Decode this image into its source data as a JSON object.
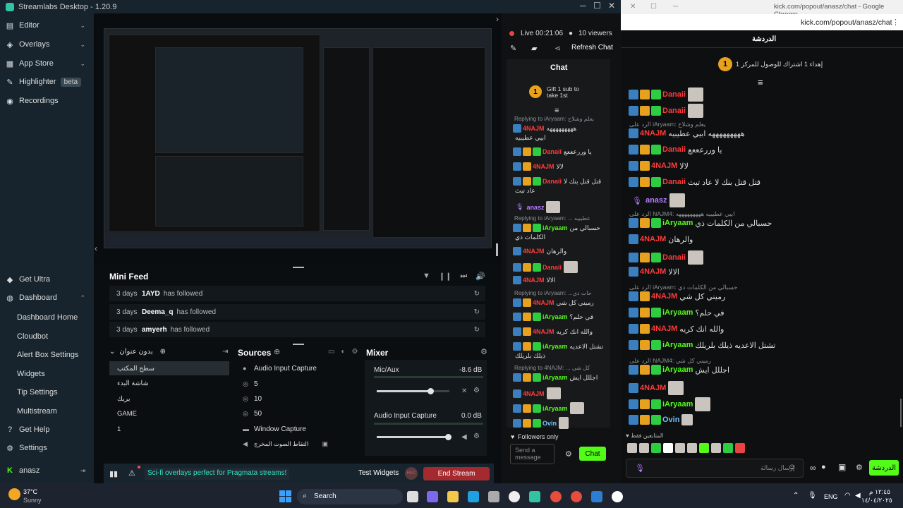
{
  "app": {
    "title": "Streamlabs Desktop - 1.20.9"
  },
  "sidebar": {
    "items": [
      {
        "label": "Editor"
      },
      {
        "label": "Overlays"
      },
      {
        "label": "App Store"
      },
      {
        "label": "Highlighter",
        "badge": "beta"
      },
      {
        "label": "Recordings"
      },
      {
        "label": "Get Ultra"
      },
      {
        "label": "Dashboard"
      },
      {
        "label": "Get Help"
      },
      {
        "label": "Settings"
      }
    ],
    "dashboard_subitems": [
      "Dashboard Home",
      "Cloudbot",
      "Alert Box Settings",
      "Widgets",
      "Tip Settings",
      "Multistream"
    ],
    "user": "anasz"
  },
  "minifeed": {
    "title": "Mini Feed",
    "rows": [
      {
        "ago": "3 days",
        "name": "1AYD",
        "action": "has followed"
      },
      {
        "ago": "3 days",
        "name": "Deema_q",
        "action": "has followed"
      },
      {
        "ago": "3 days",
        "name": "amyerh",
        "action": "has followed"
      }
    ]
  },
  "scenes": {
    "title": "بدون عنوان",
    "items": [
      "سطح المكتب",
      "شاشة البدء",
      "بريك",
      "GAME",
      "1"
    ]
  },
  "sources": {
    "title": "Sources",
    "items": [
      "Audio Input Capture",
      "5",
      "10",
      "50",
      "Window Capture",
      "التقاط الصوت المخرج"
    ]
  },
  "mixer": {
    "title": "Mixer",
    "channels": [
      {
        "name": "Mic/Aux",
        "db": "-8.6 dB",
        "level": 0.75
      },
      {
        "name": "Audio Input Capture",
        "db": "0.0 dB",
        "level": 1.0
      }
    ]
  },
  "status": {
    "promo": "Sci-fi overlays perfect for Pragmata streams!",
    "test_widgets": "Test Widgets",
    "rec": "REC",
    "end_stream": "End Stream"
  },
  "live": {
    "time": "Live 00:21:06",
    "viewers": "10 viewers",
    "refresh": "Refresh Chat"
  },
  "dock_chat": {
    "header": "Chat",
    "gift": "Gift 1 sub to take 1st",
    "replies": [
      "Replying to iAryaam: يعلم وشلاح",
      "Replying to iAryaam: ... عطيبيه",
      "Replying to iAryaam: ...حات دي",
      "Replying to 4NAJM: ... كل شي"
    ],
    "lines": [
      {
        "name": "4NAJM",
        "msg": "هههههههههه"
      },
      {
        "name": "",
        "msg": "ابيي عطيبيه"
      },
      {
        "name": "Danaii",
        "msg": "يا وررعععع"
      },
      {
        "name": "4NAJM",
        "msg": "لالا"
      },
      {
        "name": "Danaii",
        "msg": "قتل قتل بنك لا"
      },
      {
        "name": "",
        "msg": "عاد تبث"
      },
      {
        "name": "anasz",
        "msg": ""
      },
      {
        "name": "iAryaam",
        "msg": "حسبالي من"
      },
      {
        "name": "",
        "msg": "الكلمات ذي"
      },
      {
        "name": "4NAJM",
        "msg": "والرهان"
      },
      {
        "name": "Danaii",
        "msg": ""
      },
      {
        "name": "4NAJM",
        "msg": "الالا"
      },
      {
        "name": "4NAJM",
        "msg": "رميني كل شي"
      },
      {
        "name": "iAryaam",
        "msg": "في حلم؟"
      },
      {
        "name": "4NAJM",
        "msg": "والله انك كريه"
      },
      {
        "name": "iAryaam",
        "msg": "تشتل الاعديه"
      },
      {
        "name": "",
        "msg": "ذيلك بلريلك"
      },
      {
        "name": "iAryaam",
        "msg": "اجللل ايش"
      },
      {
        "name": "4NAJM",
        "msg": ""
      },
      {
        "name": "iAryaam",
        "msg": ""
      },
      {
        "name": "Ovin",
        "msg": ""
      }
    ],
    "followers_only": "Followers only",
    "placeholder": "Send a message",
    "send": "Chat"
  },
  "kick": {
    "window_title": "kick.com/popout/anasz/chat - Google Chrome",
    "url": "kick.com/popout/anasz/chat",
    "header": "الدردشة",
    "gift": "إهداء 1 اشتراك للوصول للمركز 1",
    "replies": [
      "الرد على iAryaam: يعلم وشلاح",
      "الرد على NAJM4: ابيي عطيبيه هههههههههه",
      "الرد على iAryaam: حسبالي من الكلمات ذي",
      "الرد على NAJM4: رميني كل شي"
    ],
    "lines": [
      {
        "name": "Danaii",
        "msg": ""
      },
      {
        "name": "Danaii",
        "msg": ""
      },
      {
        "name": "4NAJM",
        "msg": "هههههههههه ابيي عطيبيه"
      },
      {
        "name": "Danaii",
        "msg": "يا وررعععع"
      },
      {
        "name": "4NAJM",
        "msg": "لالا"
      },
      {
        "name": "Danaii",
        "msg": "قتل قتل بنك لا عاد تبث"
      },
      {
        "name": "anasz",
        "msg": ""
      },
      {
        "name": "iAryaam",
        "msg": "حسبالي من الكلمات ذي"
      },
      {
        "name": "4NAJM",
        "msg": "والرهان"
      },
      {
        "name": "Danaii",
        "msg": ""
      },
      {
        "name": "4NAJM",
        "msg": "الالا"
      },
      {
        "name": "4NAJM",
        "msg": "رميني كل شي"
      },
      {
        "name": "iAryaam",
        "msg": "في حلم؟"
      },
      {
        "name": "4NAJM",
        "msg": "والله انك كريه"
      },
      {
        "name": "iAryaam",
        "msg": "تشتل الاعديه ذيلك بلريلك"
      },
      {
        "name": "iAryaam",
        "msg": "اجللل ايش"
      },
      {
        "name": "4NAJM",
        "msg": ""
      },
      {
        "name": "iAryaam",
        "msg": ""
      },
      {
        "name": "Ovin",
        "msg": ""
      }
    ],
    "followers_only": "المتابعين فقط",
    "placeholder": "إرسال رسالة",
    "send": "الدردشة"
  },
  "taskbar": {
    "weather_temp": "37°C",
    "weather_desc": "Sunny",
    "search": "Search",
    "lang": "ENG",
    "time": "١٢:٤٥ م",
    "date": "١٤/٠٤/٢٠٢٥"
  },
  "colors": {
    "accent": "#31c3a2",
    "kick_green": "#53fc18",
    "end_stream": "#a52a2f"
  }
}
